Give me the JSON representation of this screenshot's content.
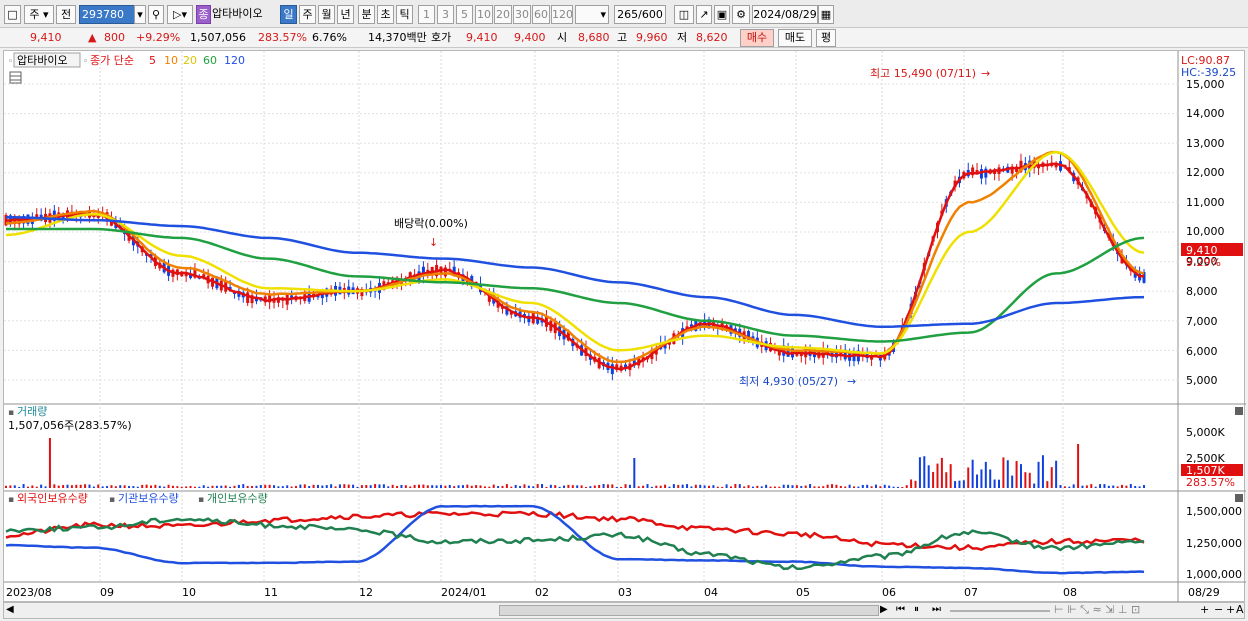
{
  "toolbar": {
    "market": "주",
    "compare": "전",
    "code": "293780",
    "stock_badge": "종",
    "stock_name": "압타바이오",
    "periods": [
      "일",
      "주",
      "월",
      "년",
      "분",
      "초",
      "틱"
    ],
    "selected_period": "일",
    "intervals": [
      "1",
      "3",
      "5",
      "10",
      "20",
      "30",
      "60",
      "120"
    ],
    "range": "265/600",
    "date": "2024/08/29"
  },
  "quote": {
    "price": "9,410",
    "change": "800",
    "change_pct": "+9.29%",
    "volume": "1,507,056",
    "volume_ratio": "283.57%",
    "turnover": "6.76%",
    "amount": "14,370백만",
    "bid_label": "호가",
    "bid1": "9,410",
    "bid2": "9,400",
    "open_label": "시",
    "open": "8,680",
    "high_label": "고",
    "high": "9,960",
    "low_label": "저",
    "low": "8,620",
    "buy_btn": "매수",
    "sell_btn": "매도",
    "eval_btn": "평"
  },
  "price_panel": {
    "stock_label": "압타바이오",
    "ma_title": "종가 단순",
    "ma_periods": [
      "5",
      "10",
      "20",
      "60",
      "120"
    ],
    "lc": "LC:90.87",
    "hc": "HC:-39.25",
    "high_annotation": "최고 15,490 (07/11)",
    "low_annotation": "최저 4,930 (05/27)",
    "dividend_annotation": "배당락(0.00%)",
    "current_price_tag": "9,410",
    "current_pct_tag": "9.29%",
    "y_ticks": [
      "15,000",
      "14,000",
      "13,000",
      "12,000",
      "11,000",
      "10,000",
      "9,000",
      "8,000",
      "7,000",
      "6,000",
      "5,000"
    ]
  },
  "volume_panel": {
    "title": "거래량",
    "value": "1,507,056주(283.57%)",
    "y_ticks": [
      "5,000K",
      "2,500K"
    ],
    "current_tag": "1,507K",
    "current_pct": "283.57%"
  },
  "holdings_panel": {
    "foreign": "외국인보유수량",
    "institution": "기관보유수량",
    "individual": "개인보유수량",
    "y_ticks": [
      "1,500,000",
      "1,250,000",
      "1,000,000"
    ]
  },
  "x_axis": [
    "2023/08",
    "09",
    "10",
    "11",
    "12",
    "2024/01",
    "02",
    "03",
    "04",
    "05",
    "06",
    "07",
    "08",
    "08/29"
  ],
  "colors": {
    "ma5": "#e01010",
    "ma10": "#f08000",
    "ma20": "#f0e000",
    "ma60": "#20a040",
    "ma120": "#2050e0",
    "up": "#e01010",
    "down": "#1040e0"
  },
  "chart_data": {
    "type": "line",
    "title": "압타바이오",
    "xlabel": "",
    "ylabel": "",
    "ylim": [
      4500,
      15800
    ],
    "x": [
      "2023/08",
      "09",
      "10",
      "11",
      "12",
      "2024/01",
      "02",
      "03",
      "04",
      "05",
      "06",
      "07",
      "08",
      "08/29"
    ],
    "series": [
      {
        "name": "5",
        "values": [
          10400,
          10600,
          8600,
          7700,
          8000,
          8700,
          7100,
          5400,
          6900,
          5900,
          5800,
          12000,
          12300,
          8500
        ]
      },
      {
        "name": "10",
        "values": [
          10300,
          10700,
          8800,
          7900,
          8000,
          8600,
          7300,
          5600,
          6800,
          6000,
          5900,
          11000,
          12700,
          8600
        ]
      },
      {
        "name": "20",
        "values": [
          9900,
          10600,
          9200,
          8100,
          8000,
          8400,
          7600,
          6000,
          6500,
          6100,
          5900,
          10000,
          12700,
          9300
        ]
      },
      {
        "name": "60",
        "values": [
          10100,
          10100,
          9800,
          9100,
          8500,
          8300,
          8100,
          7600,
          7000,
          6500,
          6300,
          6600,
          8600,
          9800
        ]
      },
      {
        "name": "120",
        "values": [
          10500,
          10400,
          10200,
          9800,
          9300,
          9100,
          8800,
          8300,
          7800,
          7200,
          6800,
          6900,
          7600,
          7800
        ]
      }
    ]
  }
}
